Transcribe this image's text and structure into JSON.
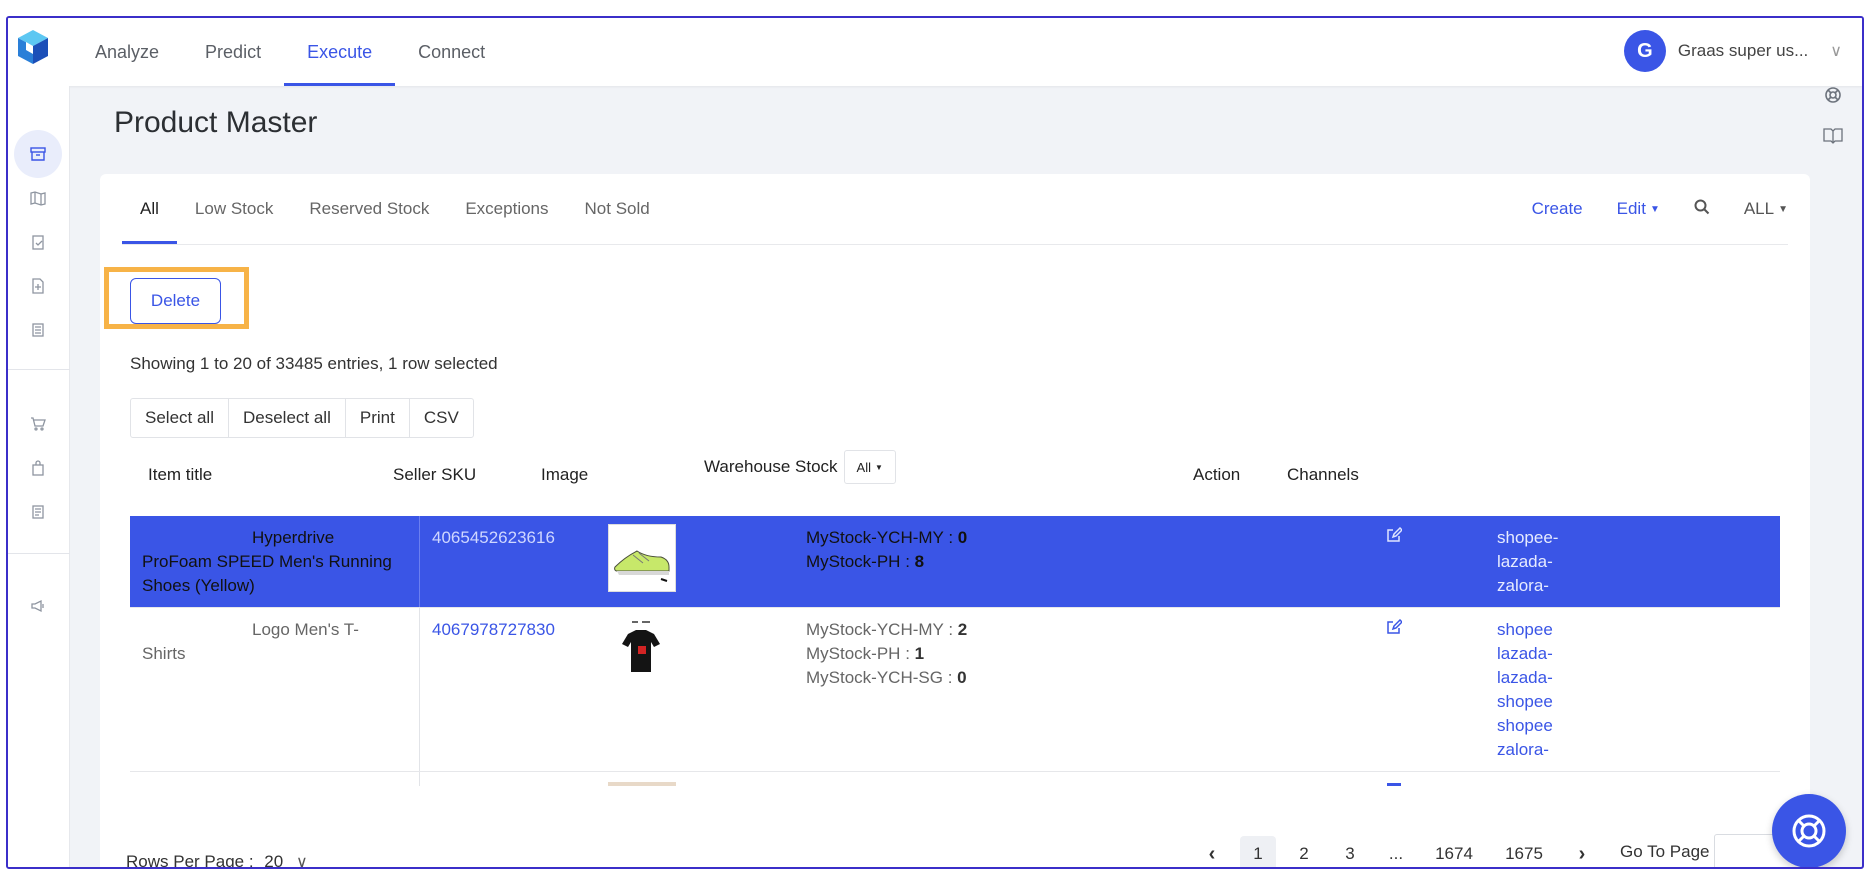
{
  "nav": {
    "items": [
      {
        "label": "Analyze"
      },
      {
        "label": "Predict"
      },
      {
        "label": "Execute"
      },
      {
        "label": "Connect"
      }
    ],
    "active": "Execute"
  },
  "user": {
    "initial": "G",
    "name": "Graas super us..."
  },
  "page": {
    "title": "Product Master"
  },
  "tabs": [
    {
      "label": "All"
    },
    {
      "label": "Low Stock"
    },
    {
      "label": "Reserved Stock"
    },
    {
      "label": "Exceptions"
    },
    {
      "label": "Not Sold"
    }
  ],
  "tools": {
    "create": "Create",
    "edit": "Edit",
    "filter": "ALL"
  },
  "delete_label": "Delete",
  "showing": "Showing 1 to 20 of 33485 entries, 1 row selected",
  "table_buttons": [
    "Select all",
    "Deselect all",
    "Print",
    "CSV"
  ],
  "columns": {
    "title": "Item title",
    "sku": "Seller SKU",
    "image": "Image",
    "stock": "Warehouse Stock",
    "stock_filter": "All",
    "action": "Action",
    "channels": "Channels"
  },
  "rows": [
    {
      "title_a": "Hyperdrive",
      "title_b": "ProFoam SPEED Men's Running Shoes (Yellow)",
      "sku": "4065452623616",
      "stock": [
        {
          "name": "MyStock-YCH-MY",
          "qty": "0"
        },
        {
          "name": "MyStock-PH",
          "qty": "8"
        }
      ],
      "channels": [
        "shopee-",
        "lazada-",
        "zalora-"
      ]
    },
    {
      "title_a": "Logo Men's T-",
      "title_b": "Shirts",
      "sku": "4067978727830",
      "stock": [
        {
          "name": "MyStock-YCH-MY",
          "qty": "2"
        },
        {
          "name": "MyStock-PH",
          "qty": "1"
        },
        {
          "name": "MyStock-YCH-SG",
          "qty": "0"
        }
      ],
      "channels": [
        "shopee",
        "lazada-",
        "lazada-",
        "shopee",
        "shopee",
        "zalora-"
      ]
    }
  ],
  "footer": {
    "rows_per_page_label": "Rows Per Page :",
    "rows_per_page_value": "20",
    "pages": [
      "1",
      "2",
      "3",
      "...",
      "1674",
      "1675"
    ],
    "current_page": "1",
    "goto_label": "Go To Page :"
  },
  "colors": {
    "accent": "#3a55e6",
    "highlight": "#f7b347",
    "frame": "#3b2fc9"
  }
}
